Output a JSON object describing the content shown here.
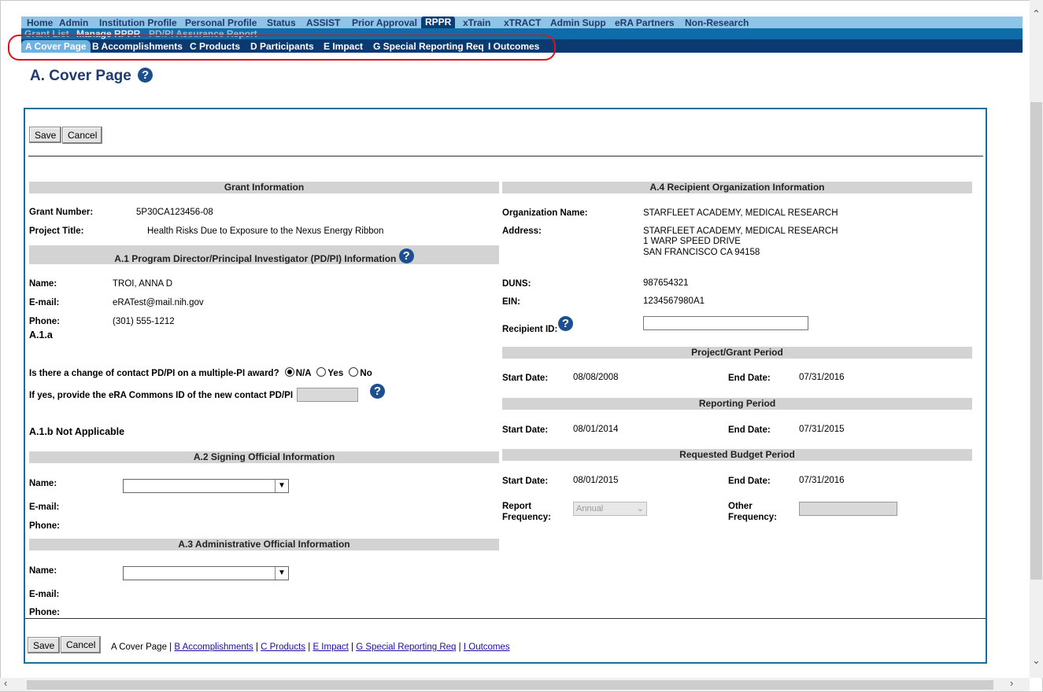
{
  "top_nav": [
    "Home",
    "Admin",
    "Institution Profile",
    "Personal Profile",
    "Status",
    "ASSIST",
    "Prior Approval",
    "RPPR",
    "xTrain",
    "xTRACT",
    "Admin Supp",
    "eRA Partners",
    "Non-Research"
  ],
  "sub_nav": [
    "Grant List",
    "Manage RPPR",
    "PD/PI Assurance Report"
  ],
  "section_tabs": [
    "A Cover Page",
    "B Accomplishments",
    "C Products",
    "D Participants",
    "E Impact",
    "G Special Reporting Req",
    "I Outcomes"
  ],
  "page_title": "A. Cover Page",
  "buttons": {
    "save": "Save",
    "cancel": "Cancel"
  },
  "grant_info": {
    "header": "Grant Information",
    "grant_number_label": "Grant Number:",
    "grant_number": "5P30CA123456-08",
    "project_title_label": "Project Title:",
    "project_title": "Health Risks Due to Exposure to the Nexus Energy Ribbon"
  },
  "pdpi": {
    "header": "A.1 Program Director/Principal Investigator (PD/PI) Information",
    "name_label": "Name:",
    "name": "TROI, ANNA D",
    "email_label": "E-mail:",
    "email": "eRATest@mail.nih.gov",
    "phone_label": "Phone:",
    "phone": "(301) 555-1212",
    "a1a": "A.1.a",
    "question": "Is there a change of contact PD/PI on a multiple-PI award?",
    "options": [
      "N/A",
      "Yes",
      "No"
    ],
    "commons_label": "If yes, provide the eRA Commons ID of the new contact PD/PI",
    "a1b": "A.1.b Not Applicable"
  },
  "signing": {
    "header": "A.2 Signing Official Information",
    "name_label": "Name:",
    "email_label": "E-mail:",
    "phone_label": "Phone:"
  },
  "admin": {
    "header": "A.3 Administrative Official Information",
    "name_label": "Name:",
    "email_label": "E-mail:",
    "phone_label": "Phone:"
  },
  "recipient": {
    "header": "A.4 Recipient Organization Information",
    "org_label": "Organization Name:",
    "org": "STARFLEET ACADEMY, MEDICAL RESEARCH",
    "address_label": "Address:",
    "address1": "STARFLEET ACADEMY, MEDICAL RESEARCH",
    "address2": "1 WARP SPEED DRIVE",
    "address3": "SAN FRANCISCO CA 94158",
    "duns_label": "DUNS:",
    "duns": "987654321",
    "ein_label": "EIN:",
    "ein": "1234567980A1",
    "recipient_id_label": "Recipient ID:"
  },
  "project_period": {
    "header": "Project/Grant Period",
    "start_label": "Start Date:",
    "start": "08/08/2008",
    "end_label": "End Date:",
    "end": "07/31/2016"
  },
  "reporting_period": {
    "header": "Reporting Period",
    "start_label": "Start Date:",
    "start": "08/01/2014",
    "end_label": "End Date:",
    "end": "07/31/2015"
  },
  "budget_period": {
    "header": "Requested Budget Period",
    "start_label": "Start Date:",
    "start": "08/01/2015",
    "end_label": "End Date:",
    "end": "07/31/2016",
    "report_freq_label1": "Report",
    "report_freq_label2": "Frequency:",
    "report_freq_value": "Annual",
    "other_freq_label1": "Other",
    "other_freq_label2": "Frequency:"
  },
  "bottom_links": {
    "current": "A Cover Page",
    "sep": "|",
    "links": [
      "B Accomplishments",
      "C Products",
      "E Impact",
      "G Special Reporting Req",
      "I Outcomes"
    ]
  }
}
